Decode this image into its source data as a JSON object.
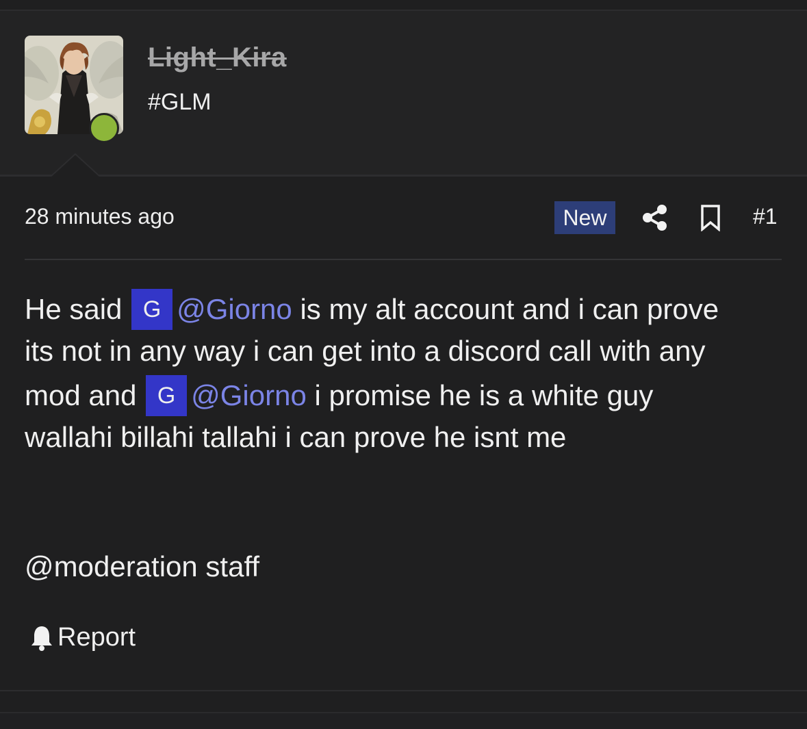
{
  "user": {
    "name": "Light_Kira",
    "title": "#GLM",
    "status": "online",
    "status_color": "#8db63a"
  },
  "post": {
    "timestamp": "28 minutes ago",
    "badge": "New",
    "number": "#1",
    "body": {
      "line1_pre": "He said",
      "line1_post": "is my alt account and i can prove",
      "line2": "its not in any way i can get into a discord call with any",
      "line3_pre": "mod and",
      "line3_post": "i promise he is a white guy",
      "line4": "wallahi billahi tallahi i can prove he isnt me",
      "line5": "@moderation staff"
    },
    "mention": {
      "initial": "G",
      "name": "@Giorno",
      "avatar_color": "#3336c8",
      "link_color": "#7b84e6"
    }
  },
  "actions": {
    "report_label": "Report",
    "share_icon": "share-icon",
    "bookmark_icon": "bookmark-icon",
    "report_icon": "bell-icon"
  },
  "colors": {
    "background": "#1f1f20",
    "badge_background": "#2d3e78"
  }
}
